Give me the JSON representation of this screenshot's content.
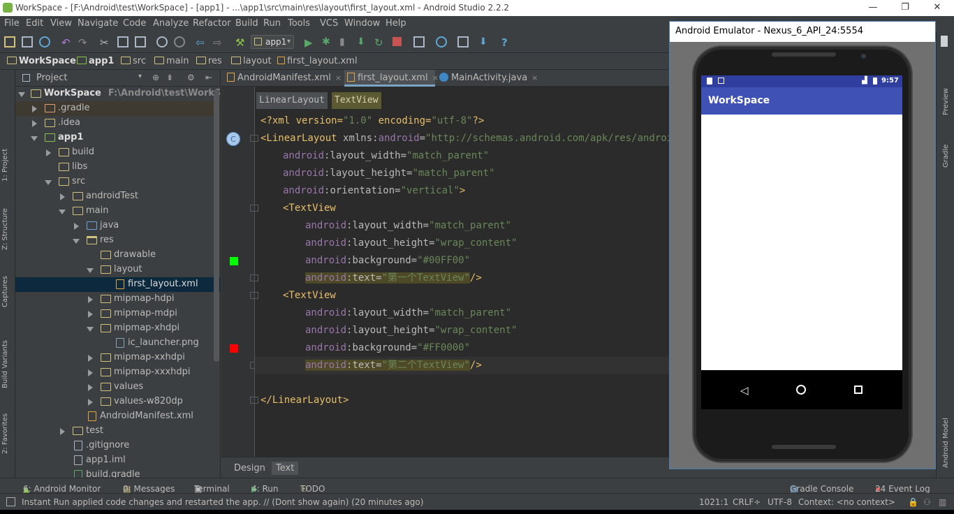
{
  "window": {
    "title": "WorkSpace - [F:\\Android\\test\\WorkSpace] - [app1] - ...\\app1\\src\\main\\res\\layout\\first_layout.xml - Android Studio 2.2.2",
    "minimize": "—",
    "restore": "❐",
    "close": "✕"
  },
  "menu": [
    "File",
    "Edit",
    "View",
    "Navigate",
    "Code",
    "Analyze",
    "Refactor",
    "Build",
    "Run",
    "Tools",
    "VCS",
    "Window",
    "Help"
  ],
  "toolbar": {
    "run_config": "app1"
  },
  "breadcrumb": [
    "WorkSpace",
    "app1",
    "src",
    "main",
    "res",
    "layout",
    "first_layout.xml"
  ],
  "left_stripe": {
    "project": "1: Project",
    "structure": "Z: Structure",
    "captures": "Captures",
    "build_variants": "Build Variants",
    "favorites": "2: Favorites"
  },
  "project": {
    "header": "Project",
    "tree": [
      {
        "label": "WorkSpace",
        "path": "F:\\Android\\test\\WorkSpace"
      },
      {
        "label": ".gradle"
      },
      {
        "label": ".idea"
      },
      {
        "label": "app1"
      },
      {
        "label": "build"
      },
      {
        "label": "libs"
      },
      {
        "label": "src"
      },
      {
        "label": "androidTest"
      },
      {
        "label": "main"
      },
      {
        "label": "java"
      },
      {
        "label": "res"
      },
      {
        "label": "drawable"
      },
      {
        "label": "layout"
      },
      {
        "label": "first_layout.xml"
      },
      {
        "label": "mipmap-hdpi"
      },
      {
        "label": "mipmap-mdpi"
      },
      {
        "label": "mipmap-xhdpi"
      },
      {
        "label": "ic_launcher.png"
      },
      {
        "label": "mipmap-xxhdpi"
      },
      {
        "label": "mipmap-xxxhdpi"
      },
      {
        "label": "values"
      },
      {
        "label": "values-w820dp"
      },
      {
        "label": "AndroidManifest.xml"
      },
      {
        "label": "test"
      },
      {
        "label": ".gitignore"
      },
      {
        "label": "app1.iml"
      },
      {
        "label": "build.gradle"
      }
    ]
  },
  "tabs": [
    {
      "label": "AndroidManifest.xml",
      "close": "×"
    },
    {
      "label": "first_layout.xml",
      "close": "×"
    },
    {
      "label": "MainActivity.java",
      "close": "×"
    }
  ],
  "editor": {
    "xml_breadcrumb": [
      "LinearLayout",
      "TextView"
    ],
    "gutter_marker": "C",
    "colors": {
      "green": "#00FF00",
      "red": "#FF0000"
    },
    "code": {
      "l1a": "<?xml version=",
      "l1b": "\"1.0\"",
      "l1c": " encoding=",
      "l1d": "\"utf-8\"",
      "l1e": "?>",
      "l2a": "<LinearLayout ",
      "l2b": "xmlns:",
      "l2c": "android",
      "l2d": "=",
      "l2e": "\"http://schemas.android.com/apk/res/android\"",
      "ns": "android",
      "a_lw": ":layout_width=",
      "v_mp": "\"match_parent\"",
      "a_lh": ":layout_height=",
      "v_wc": "\"wrap_content\"",
      "a_or": ":orientation=",
      "v_vert": "\"vertical\"",
      "close_gt": ">",
      "tv_open": "<TextView",
      "a_bg": ":background=",
      "v_green": "\"#00FF00\"",
      "v_red": "\"#FF0000\"",
      "a_text": ":text=",
      "v_text1": "\"第一个TextView\"",
      "v_text2": "\"第二个TextView\"",
      "self_close": "/>",
      "ll_close": "</LinearLayout>"
    }
  },
  "design_tabs": [
    "Design",
    "Text"
  ],
  "emulator": {
    "title": "Android Emulator - Nexus_6_API_24:5554",
    "time": "9:57",
    "app_title": "WorkSpace"
  },
  "right_stripe": {
    "preview": "Preview",
    "gradle": "Gradle",
    "android_model": "Android Model"
  },
  "bottom_tools": {
    "android_monitor": "6: Android Monitor",
    "messages": "0: Messages",
    "terminal": "Terminal",
    "run": "4: Run",
    "todo": "TODO",
    "gradle_console": "Gradle Console",
    "event_log": "24 Event Log"
  },
  "status": {
    "message": "Instant Run applied code changes and restarted the app. // (Dont show again) (20 minutes ago)",
    "position": "1021:1",
    "line_sep": "CRLF÷",
    "encoding": "UTF-8",
    "context": "Context: <no context>"
  }
}
